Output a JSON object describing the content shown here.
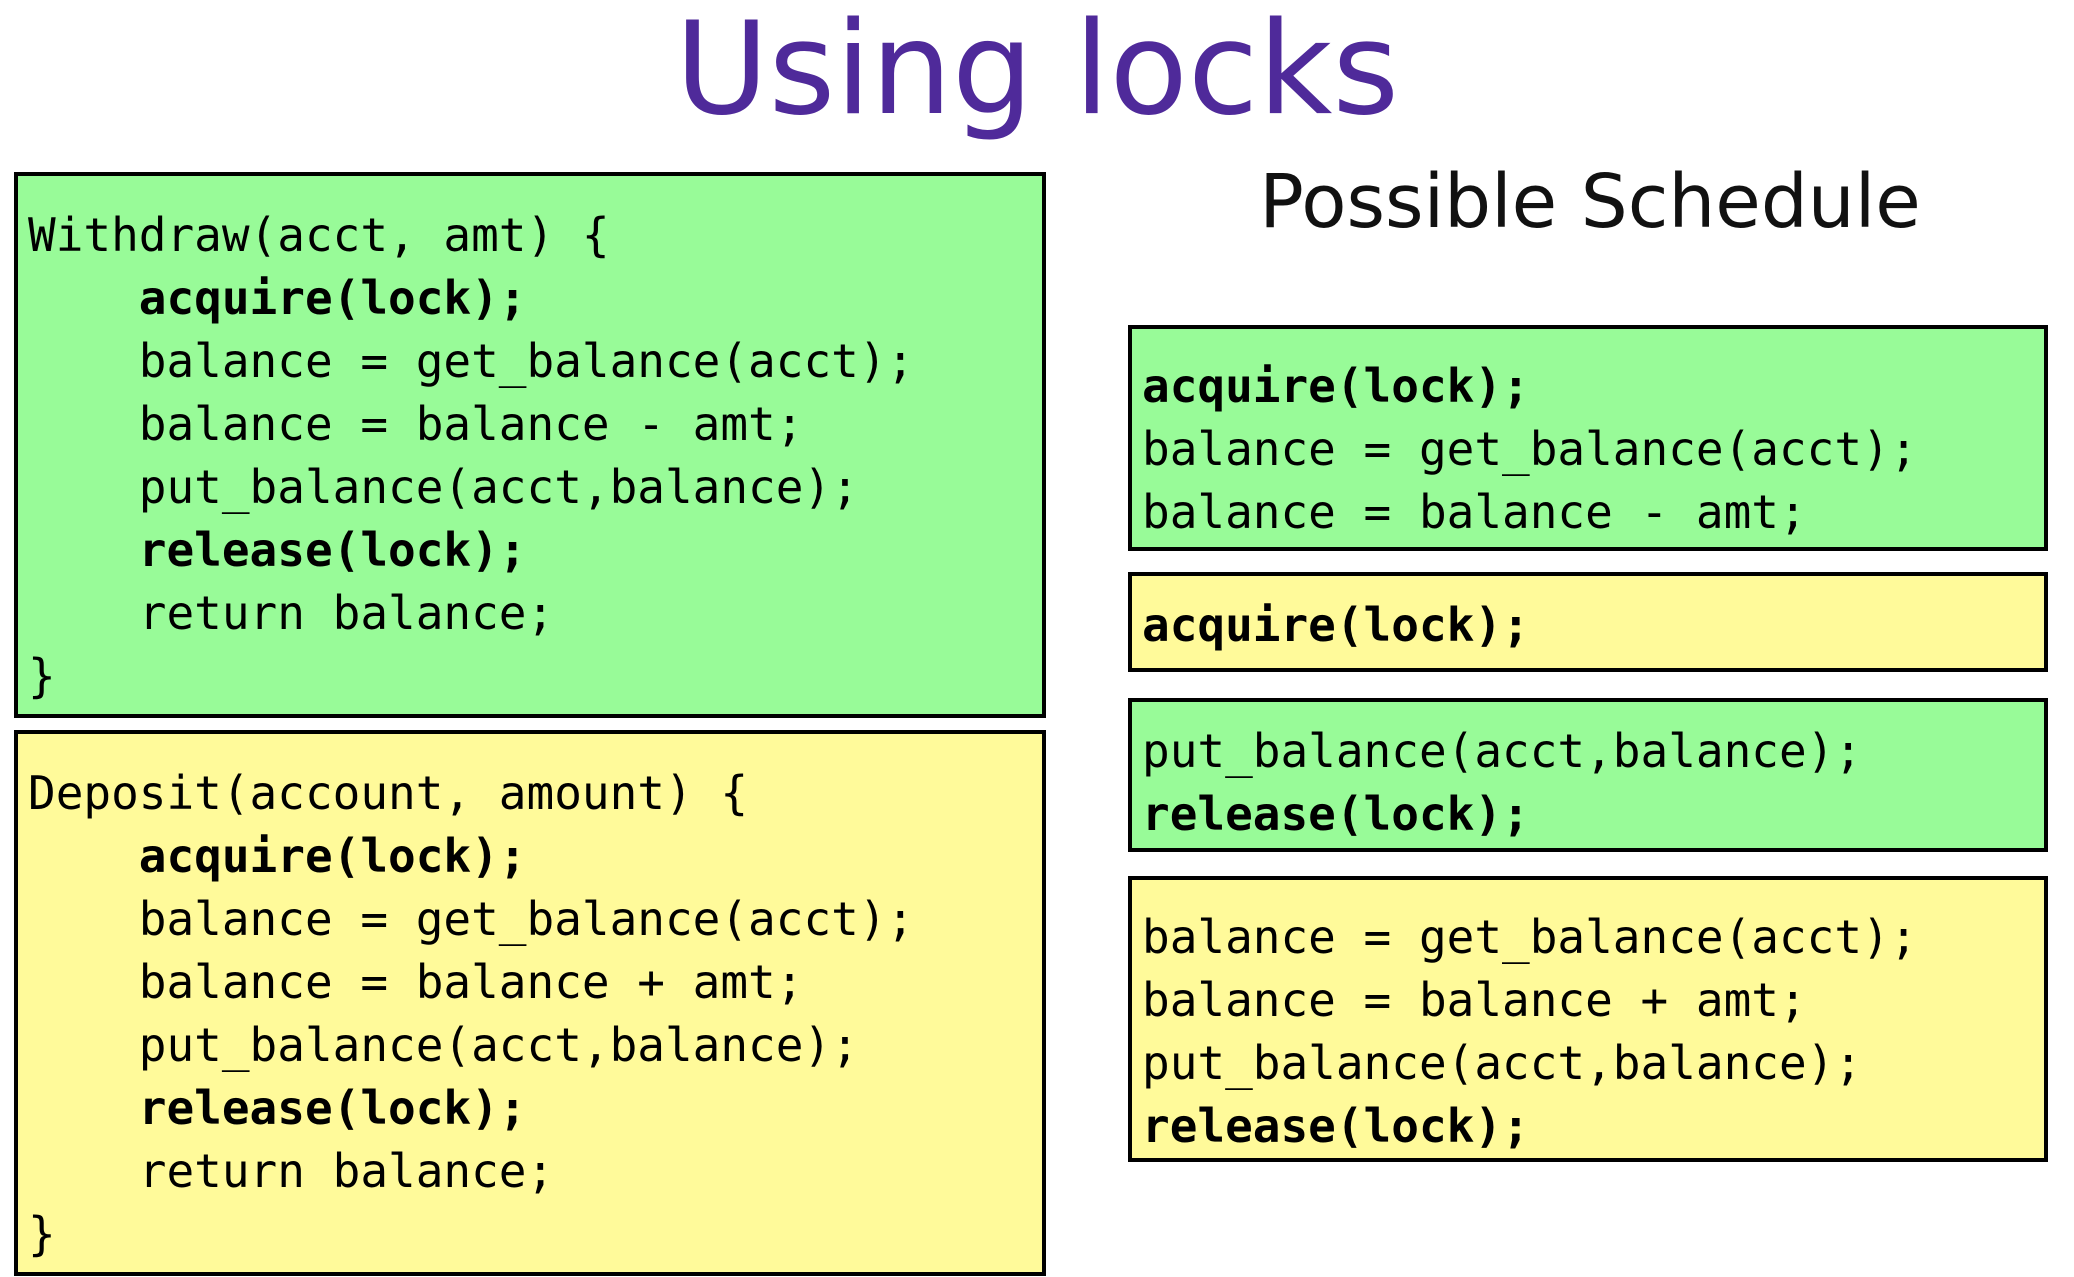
{
  "title": "Using locks",
  "subtitle": "Possible Schedule",
  "colors": {
    "title": "#4f2a9a",
    "green_box": "#98fb98",
    "yellow_box": "#fffa9a",
    "border": "#000000"
  },
  "withdraw": {
    "lines": [
      {
        "text": "Withdraw(acct, amt) {",
        "bold": false
      },
      {
        "text": "    acquire(lock);",
        "bold": true
      },
      {
        "text": "    balance = get_balance(acct);",
        "bold": false
      },
      {
        "text": "    balance = balance - amt;",
        "bold": false
      },
      {
        "text": "    put_balance(acct,balance);",
        "bold": false
      },
      {
        "text": "    release(lock);",
        "bold": true
      },
      {
        "text": "    return balance;",
        "bold": false
      },
      {
        "text": "}",
        "bold": false
      }
    ]
  },
  "deposit": {
    "lines": [
      {
        "text": "Deposit(account, amount) {",
        "bold": false
      },
      {
        "text": "    acquire(lock);",
        "bold": true
      },
      {
        "text": "    balance = get_balance(acct);",
        "bold": false
      },
      {
        "text": "    balance = balance + amt;",
        "bold": false
      },
      {
        "text": "    put_balance(acct,balance);",
        "bold": false
      },
      {
        "text": "    release(lock);",
        "bold": true
      },
      {
        "text": "    return balance;",
        "bold": false
      },
      {
        "text": "}",
        "bold": false
      }
    ]
  },
  "schedule": [
    {
      "lines": [
        {
          "text": "acquire(lock);",
          "bold": true
        },
        {
          "text": "balance = get_balance(acct);",
          "bold": false
        },
        {
          "text": "balance = balance - amt;",
          "bold": false
        }
      ]
    },
    {
      "lines": [
        {
          "text": "acquire(lock);",
          "bold": true
        }
      ]
    },
    {
      "lines": [
        {
          "text": "put_balance(acct,balance);",
          "bold": false
        },
        {
          "text": "release(lock);",
          "bold": true
        }
      ]
    },
    {
      "lines": [
        {
          "text": "balance = get_balance(acct);",
          "bold": false
        },
        {
          "text": "balance = balance + amt;",
          "bold": false
        },
        {
          "text": "put_balance(acct,balance);",
          "bold": false
        },
        {
          "text": "release(lock);",
          "bold": true
        }
      ]
    }
  ]
}
